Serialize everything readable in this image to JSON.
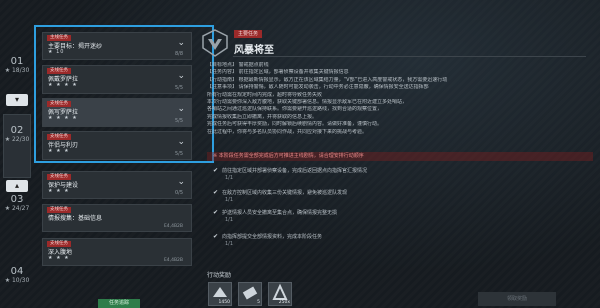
{
  "chapters": [
    {
      "num": "01",
      "stars": "★ 18/30"
    },
    {
      "num": "02",
      "stars": "★ 22/30"
    },
    {
      "num": "03",
      "stars": "★ 24/27"
    },
    {
      "num": "04",
      "stars": "★ 10/30"
    }
  ],
  "quests": [
    {
      "tag": "主线任务",
      "title": "主要目标：揭开迷纱",
      "stars": "★ 10",
      "progress": "8/8"
    },
    {
      "tag": "支线任务",
      "title": "佩戴罗萨拉",
      "stars": "★ ★ ★ ★",
      "progress": "5/5"
    },
    {
      "tag": "支线任务",
      "title": "佩写罗萨拉",
      "stars": "★ ★ ★ ★",
      "progress": "5/5"
    },
    {
      "tag": "支线任务",
      "title": "伴侣与利刃",
      "stars": "★ ★ ★",
      "progress": "5/5"
    },
    {
      "tag": "支线任务",
      "title": "保护与建设",
      "stars": "★ ★ ★",
      "progress": "0/5"
    },
    {
      "tag": "支线任务",
      "title": "情报搜集：基础信息",
      "stars": "",
      "coord": "E4,4B2B"
    },
    {
      "tag": "支线任务",
      "title": "深入腹地",
      "stars": "★ ★ ★",
      "coord": "E4,4B2B"
    }
  ],
  "detail": {
    "tag": "主要任务",
    "title": "风暴将至",
    "description": [
      "【目标地点】 警戒据点前线",
      "【任务内容】 前往指定区域，部署侦察设备并收集关键情报信息",
      "【行动指南】 根据最新情报显示，敌方正在该区域集结力量，“V部”已进入高度警戒状态，我方需要迅速行动",
      "【注意事项】 请保持警惕，敌人随时可能发动袭击，行动中务必注意隐蔽，确保情报安全送达指挥部",
      "            所有行动需在规定时间内完成，超时将导致任务失败",
      "本次行动需要你深入敌方腹地，获取关键部署信息。情报显示敌军已在附近建立多处哨站，",
      "各哨站之间通过巡逻队保持联系。你需要避开巡逻路线，找到合适的观察位置，",
      "完成情报收集后立即撤离，并将获取的信息上报。",
      "完成任务后可获得丰厚奖励，同时解锁后续剧情内容。请做好准备，谨慎行动。",
      "在此过程中，你将与多名队员协同作战，共同应对接下来的挑战与考验。"
    ],
    "warning": "※ 本阶段任务需全部完成后方可推进主线剧情，请合理安排行动顺序",
    "objectives": [
      {
        "text": "前往指定区域并部署侦察设备，完成后返回据点向指挥官汇报情况",
        "progress": "1/1"
      },
      {
        "text": "在敌方控制区域内收集三份关键情报，避免被巡逻队发现",
        "progress": "1/1"
      },
      {
        "text": "护送情报人员安全撤离至集合点，确保情报完整无损",
        "progress": "1/1"
      },
      {
        "text": "向指挥部提交全部情报资料，完成本阶段任务",
        "progress": "1/1"
      }
    ],
    "reward_label": "行动奖励",
    "rewards": [
      {
        "count": "1450"
      },
      {
        "count": "5"
      },
      {
        "count": "250x"
      }
    ],
    "claim_label": "领取奖励",
    "quick_label": "任务追踪"
  }
}
